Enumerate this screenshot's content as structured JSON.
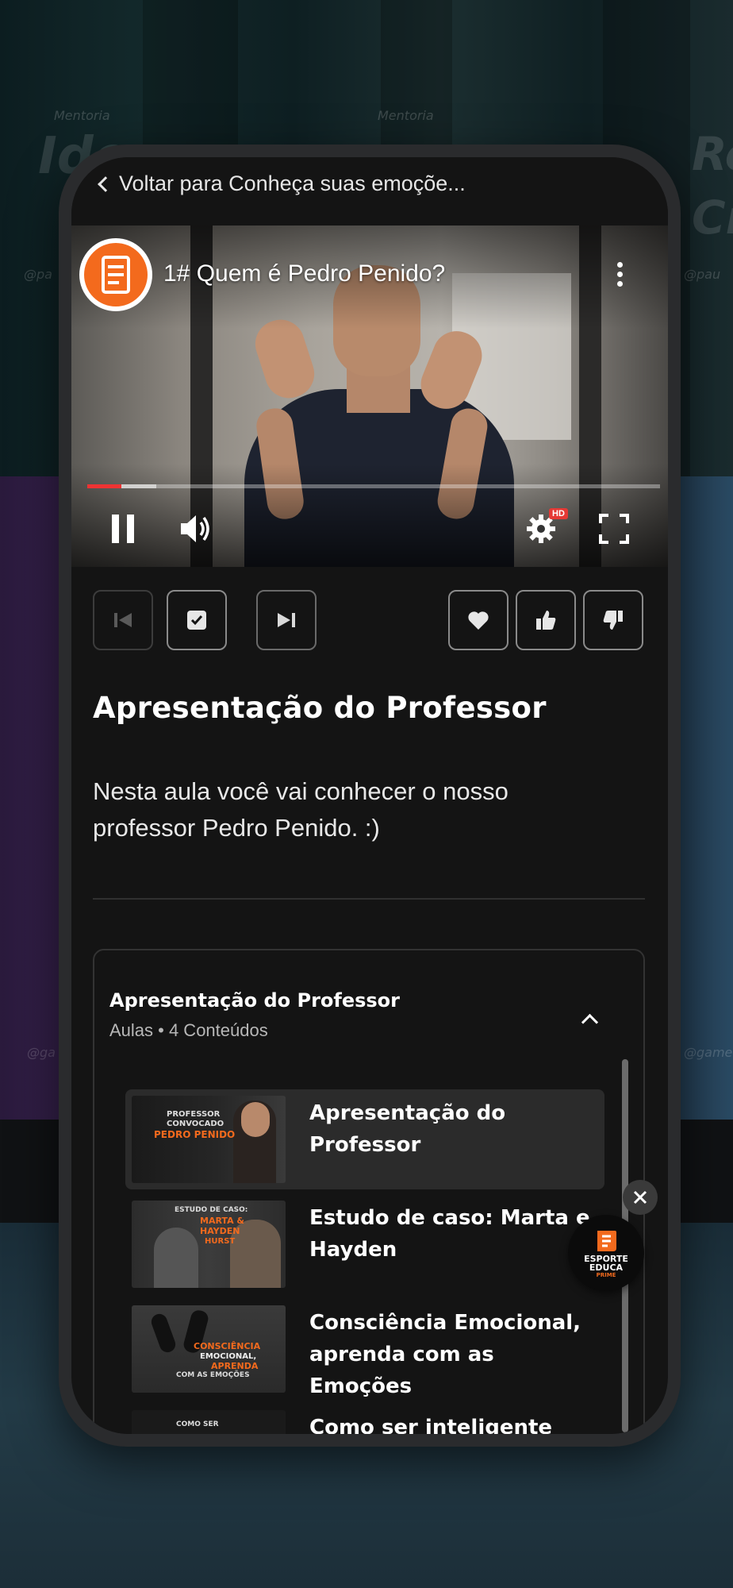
{
  "background": {
    "texts": [
      "Mentoria",
      "Ide",
      "Mentoria",
      "Re",
      "Cr",
      "@pa",
      "@pau",
      "@ga",
      "@game"
    ]
  },
  "nav": {
    "back_label": "Voltar para Conheça suas emoçõe..."
  },
  "video": {
    "title": "1# Quem é Pedro Penido?",
    "progress": 0.06,
    "buffered": 0.12,
    "quality_badge": "HD",
    "icons": [
      "pause-icon",
      "volume-icon",
      "settings-icon",
      "fullscreen-icon",
      "more-vertical-icon"
    ]
  },
  "actions": {
    "icons": [
      "previous-lesson-icon",
      "mark-complete-icon",
      "next-lesson-icon",
      "favorite-icon",
      "like-icon",
      "dislike-icon"
    ]
  },
  "lesson": {
    "title": "Apresentação do Professor",
    "description": "Nesta aula você vai conhecer o nosso professor Pedro Penido. :)"
  },
  "module": {
    "title": "Apresentação do Professor",
    "subtitle": "Aulas • 4 Conteúdos",
    "items": [
      {
        "label": "Apresentação do Professor",
        "thumb_lines": [
          "PROFESSOR",
          "CONVOCADO",
          "PEDRO PENIDO"
        ],
        "active": true
      },
      {
        "label": "Estudo de caso: Marta e Hayden",
        "thumb_lines": [
          "ESTUDO DE CASO:",
          "MARTA &",
          "HAYDEN",
          "HURST"
        ],
        "active": false
      },
      {
        "label": "Consciência Emocional, aprenda com as Emoções",
        "thumb_lines": [
          "CONSCIÊNCIA",
          "EMOCIONAL,",
          "APRENDA",
          "COM AS EMOÇÕES"
        ],
        "active": false
      },
      {
        "label": "Como ser inteligente",
        "thumb_lines": [
          "COMO SER"
        ],
        "active": false
      }
    ]
  },
  "widget": {
    "logo_line1": "ESPORTE",
    "logo_line2": "EDUCA",
    "logo_line3": "PRIME"
  },
  "colors": {
    "accent": "#f36a1d",
    "background": "#141414",
    "progress": "#e33333"
  }
}
